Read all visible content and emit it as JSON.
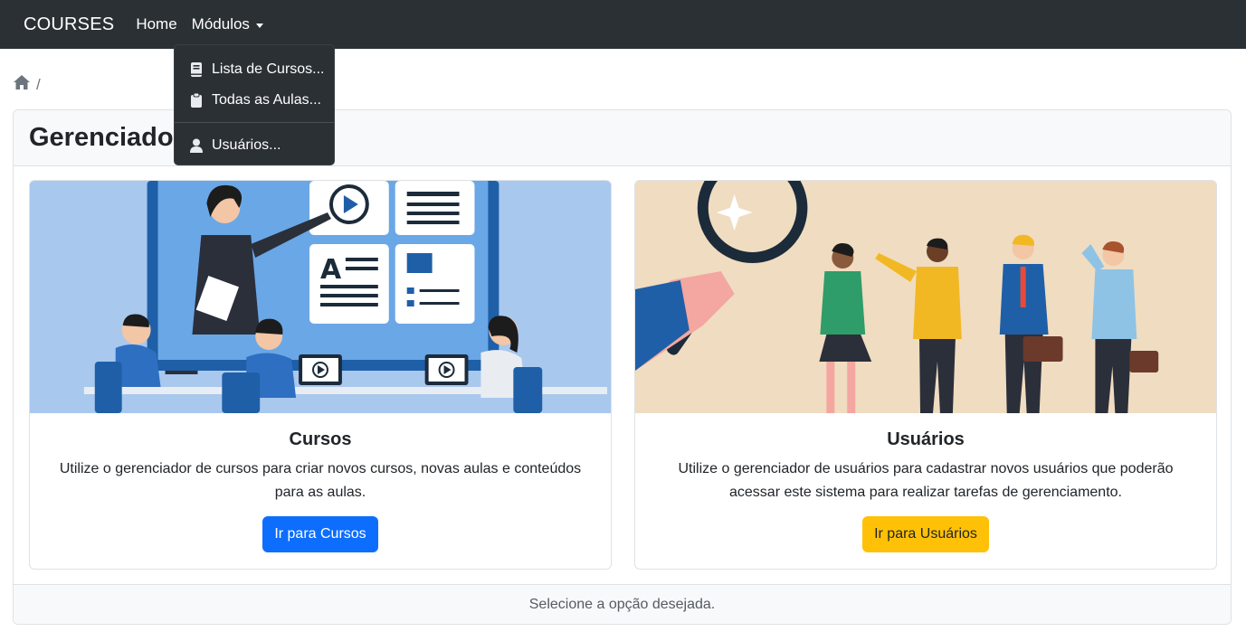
{
  "navbar": {
    "brand": "COURSES",
    "home_label": "Home",
    "modules_label": "Módulos"
  },
  "dropdown": {
    "items": [
      {
        "label": "Lista de Cursos...",
        "icon": "book-icon"
      },
      {
        "label": "Todas as Aulas...",
        "icon": "clipboard-icon"
      },
      {
        "label": "Usuários...",
        "icon": "user-icon"
      }
    ]
  },
  "breadcrumb": {
    "home_icon": "home-icon",
    "separator": "/"
  },
  "panel": {
    "title": "Gerenciador",
    "footer": "Selecione a opção desejada."
  },
  "cards": [
    {
      "title": "Cursos",
      "text": "Utilize o gerenciador de cursos para criar novos cursos, novas aulas e conteúdos para as aulas.",
      "button": "Ir para Cursos",
      "button_color": "#0d6efd"
    },
    {
      "title": "Usuários",
      "text": "Utilize o gerenciador de usuários para cadastrar novos usuários que poderão acessar este sistema para realizar tarefas de gerenciamento.",
      "button": "Ir para Usuários",
      "button_color": "#ffc107"
    }
  ],
  "colors": {
    "navbar_bg": "#2b3035",
    "primary": "#0d6efd",
    "warning": "#ffc107",
    "courses_illustration_bg": "#a8c8ee",
    "users_illustration_bg": "#f0dcc0"
  }
}
